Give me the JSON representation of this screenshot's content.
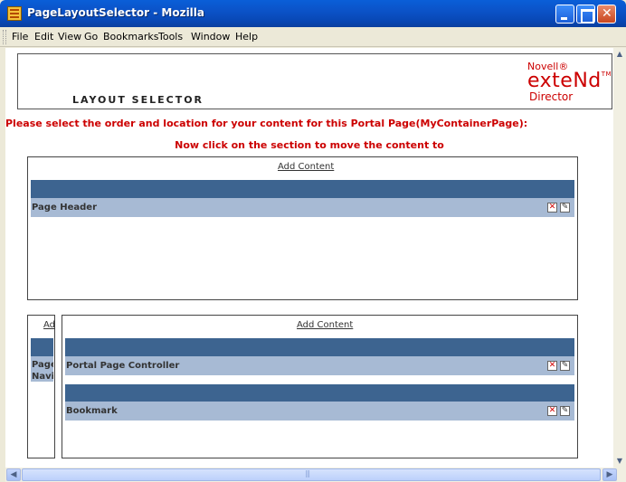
{
  "window": {
    "title": "PageLayoutSelector - Mozilla"
  },
  "menu": [
    "File",
    "Edit",
    "View",
    "Go",
    "Bookmarks",
    "Tools",
    "Window",
    "Help"
  ],
  "header": {
    "title": "LAYOUT SELECTOR",
    "logo_line1": "Novell®",
    "logo_line2": "exteNd",
    "logo_tm": "TM",
    "logo_line3": "Director"
  },
  "instructions": {
    "line1": "Please select the order and location for your content for this Portal Page(MyContainerPage):",
    "line2": "Now click on the section to move the content to"
  },
  "sections": {
    "top": {
      "add_content": "Add Content",
      "portlets": [
        {
          "label": "Page Header"
        }
      ]
    },
    "left": {
      "add_content": "Ad",
      "portlets": [
        {
          "label": "Page Navig"
        }
      ]
    },
    "main": {
      "add_content": "Add Content",
      "portlets": [
        {
          "label": "Portal Page Controller"
        },
        {
          "label": "Bookmark"
        }
      ]
    }
  },
  "icons": {
    "delete": "delete-x-icon",
    "edit": "edit-pencil-icon"
  },
  "colors": {
    "band_dark": "#3d6490",
    "band_light": "#a7bad4",
    "accent_red": "#cc0000"
  }
}
